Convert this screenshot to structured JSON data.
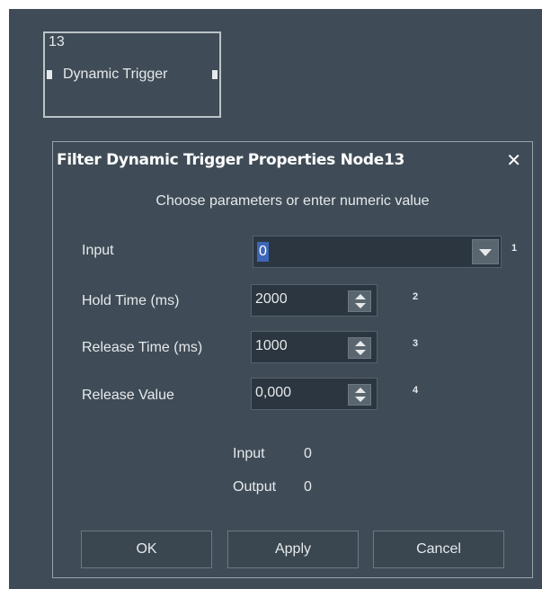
{
  "node": {
    "number": "13",
    "title": "Dynamic Trigger"
  },
  "dialog": {
    "title": "Filter Dynamic Trigger Properties Node13",
    "close_glyph": "✕",
    "subtitle": "Choose parameters or enter numeric value",
    "input": {
      "label": "Input",
      "value": "0",
      "index": "1"
    },
    "hold_time": {
      "label": "Hold Time (ms)",
      "value": "2000",
      "index": "2"
    },
    "release_time": {
      "label": "Release Time (ms)",
      "value": "1000",
      "index": "3"
    },
    "release_value": {
      "label": "Release Value",
      "value": "0,000",
      "index": "4"
    },
    "readout": {
      "input_label": "Input",
      "input_value": "0",
      "output_label": "Output",
      "output_value": "0"
    },
    "buttons": {
      "ok": "OK",
      "apply": "Apply",
      "cancel": "Cancel"
    }
  },
  "colors": {
    "background": "#3f4c57",
    "field_bg": "#2b3640",
    "selection": "#3d66b8",
    "text": "#e6e9eb"
  },
  "icons": {
    "close": "close-icon",
    "dropdown": "chevron-down-icon",
    "spin": "spinner-arrows-icon"
  }
}
